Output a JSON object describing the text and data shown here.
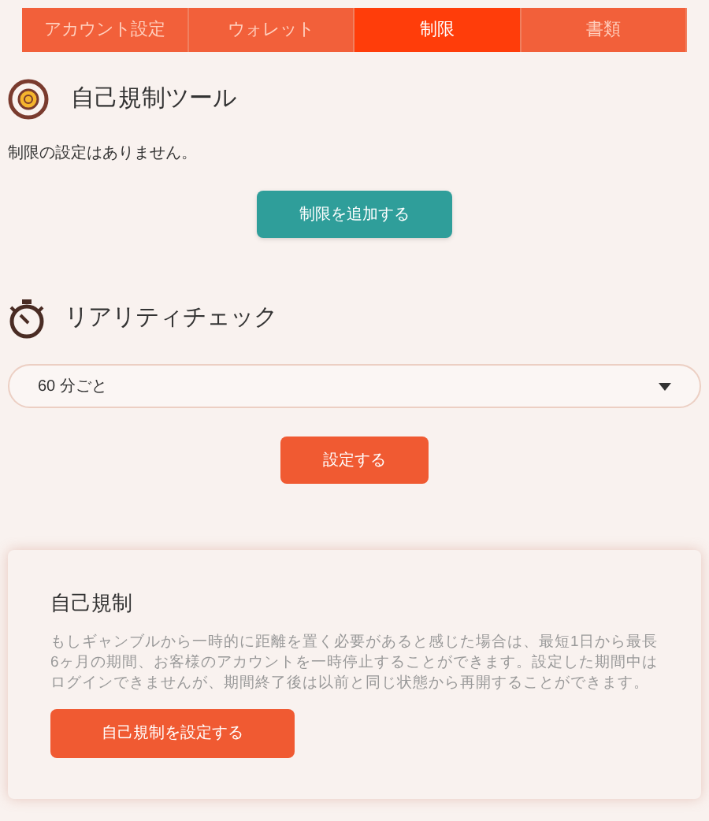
{
  "tabs": [
    {
      "label": "アカウント設定",
      "selected": false
    },
    {
      "label": "ウォレット",
      "selected": false
    },
    {
      "label": "制限",
      "selected": true
    },
    {
      "label": "書類",
      "selected": false
    }
  ],
  "self_regulation_tool": {
    "title": "自己規制ツール",
    "message": "制限の設定はありません。",
    "button": "制限を追加する"
  },
  "reality_check": {
    "title": "リアリティチェック",
    "select_value": "60 分ごと",
    "button": "設定する"
  },
  "self_exclusion": {
    "title": "自己規制",
    "description": "もしギャンブルから一時的に距離を置く必要があると感じた場合は、最短1日から最長6ヶ月の期間、お客様のアカウントを一時停止することができます。設定した期間中はログインできませんが、期間終了後は以前と同じ状態から再開することができます。",
    "button": "自己規制を設定する"
  }
}
